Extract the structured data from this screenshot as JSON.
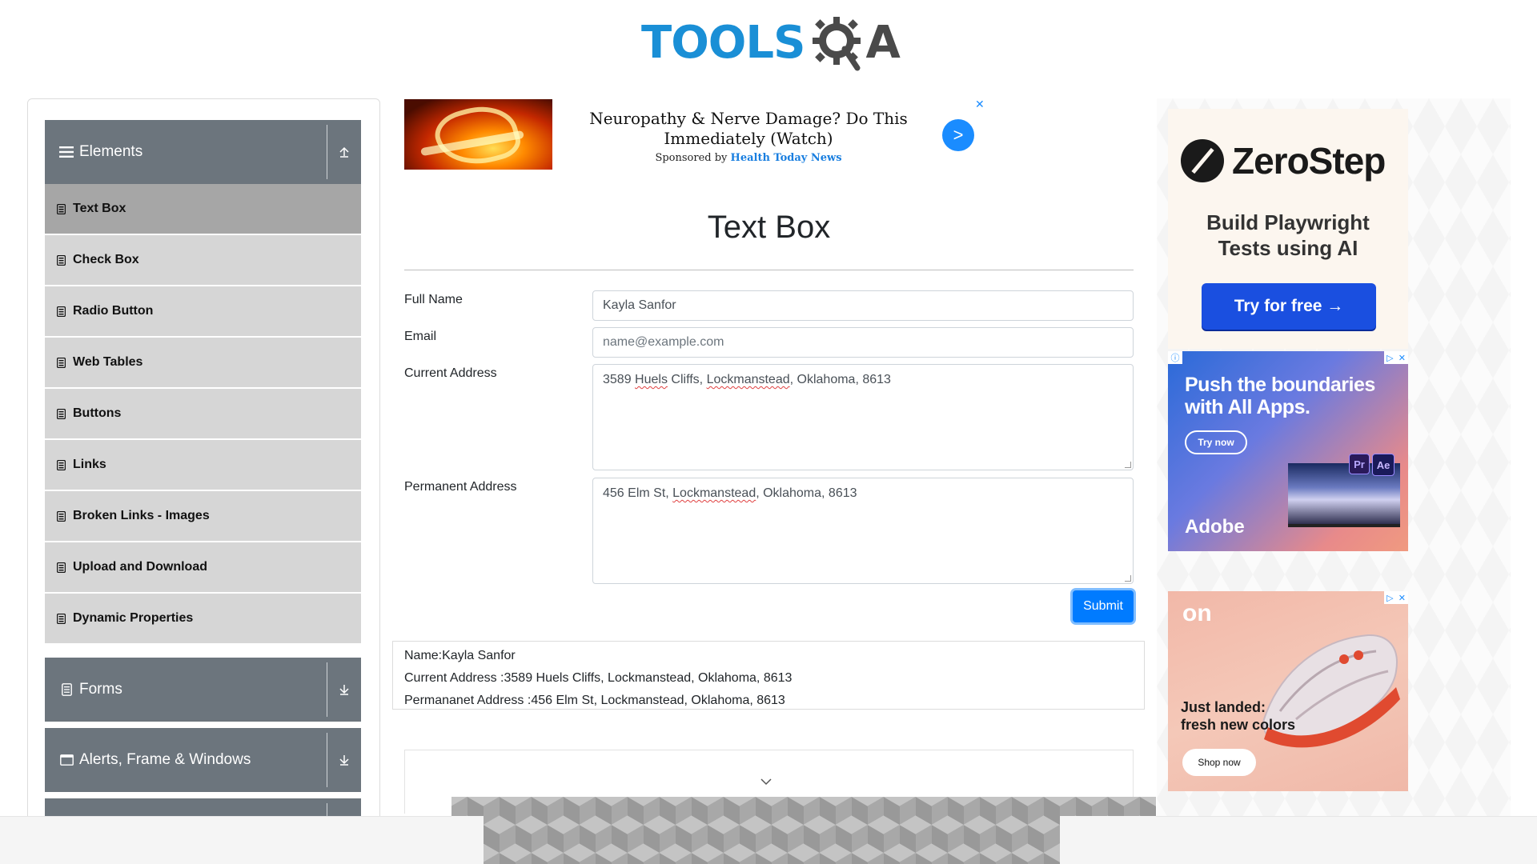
{
  "header": {
    "logo_tools": "TOOLS",
    "logo_qa": "A"
  },
  "sidebar": {
    "groups": [
      {
        "label": "Elements",
        "icon": "hamburger-icon",
        "toggle": "collapse-up-icon"
      },
      {
        "label": "Forms",
        "icon": "document-icon",
        "toggle": "expand-down-icon"
      },
      {
        "label": "Alerts, Frame & Windows",
        "icon": "window-icon",
        "toggle": "expand-down-icon"
      }
    ],
    "items": [
      {
        "label": "Text Box",
        "active": true
      },
      {
        "label": "Check Box"
      },
      {
        "label": "Radio Button"
      },
      {
        "label": "Web Tables"
      },
      {
        "label": "Buttons"
      },
      {
        "label": "Links"
      },
      {
        "label": "Broken Links - Images"
      },
      {
        "label": "Upload and Download"
      },
      {
        "label": "Dynamic Properties"
      }
    ]
  },
  "top_ad": {
    "headline": "Neuropathy & Nerve Damage? Do This Immediately (Watch)",
    "sponsored_prefix": "Sponsored by",
    "sponsor": "Health Today News",
    "arrow": ">",
    "close": "✕"
  },
  "main": {
    "title": "Text Box",
    "form": {
      "full_name_label": "Full Name",
      "full_name_value": "Kayla Sanfor",
      "email_label": "Email",
      "email_placeholder": "name@example.com",
      "current_address_label": "Current Address",
      "current_address_value": {
        "part1": "3589 ",
        "part2": "Huels",
        "part3": " Cliffs, ",
        "part4": "Lockmanstead",
        "part5": ", Oklahoma, 8613"
      },
      "permanent_address_label": "Permanent Address",
      "permanent_address_value": {
        "part1": "456 Elm St, ",
        "part2": "Lockmanstead",
        "part3": ", Oklahoma, 8613"
      },
      "submit_label": "Submit"
    },
    "output": {
      "name": "Name:Kayla Sanfor",
      "current_address": "Current Address :3589 Huels Cliffs, Lockmanstead, Oklahoma, 8613",
      "permanent_address": "Permananet Address :456 Elm St, Lockmanstead, Oklahoma, 8613"
    }
  },
  "right_ads": {
    "zerostep": {
      "name": "ZeroStep",
      "tagline_line1": "Build Playwright",
      "tagline_line2": "Tests using AI",
      "button": "Try for free →"
    },
    "adobe": {
      "headline_line1": "Push the boundaries",
      "headline_line2": "with All Apps.",
      "button": "Try now",
      "brand": "Adobe",
      "pr": "Pr",
      "ae": "Ae"
    },
    "on": {
      "logo": "on",
      "headline_line1": "Just landed:",
      "headline_line2": "fresh new colors",
      "button": "Shop now"
    }
  },
  "colors": {
    "brand_blue": "#1a8fd6",
    "sidebar_header": "#6c757d",
    "menu_item": "#d6d6d6",
    "menu_item_active": "#a6a6a6",
    "submit": "#007bff"
  }
}
